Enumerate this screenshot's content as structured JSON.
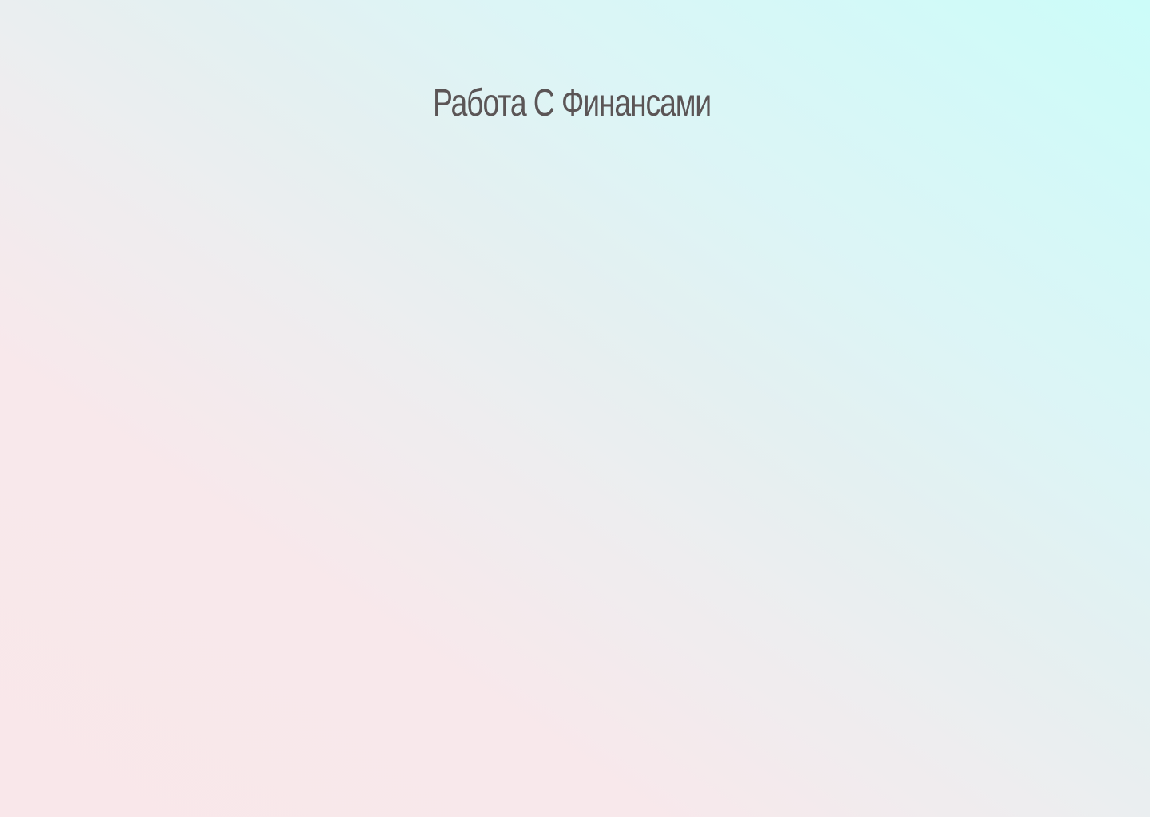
{
  "page": {
    "title": "Работа С Финансами",
    "colors": {
      "background_left": "#f9e7ea",
      "background_right": "#ccfcf9",
      "title_text": "#5b5556"
    }
  }
}
